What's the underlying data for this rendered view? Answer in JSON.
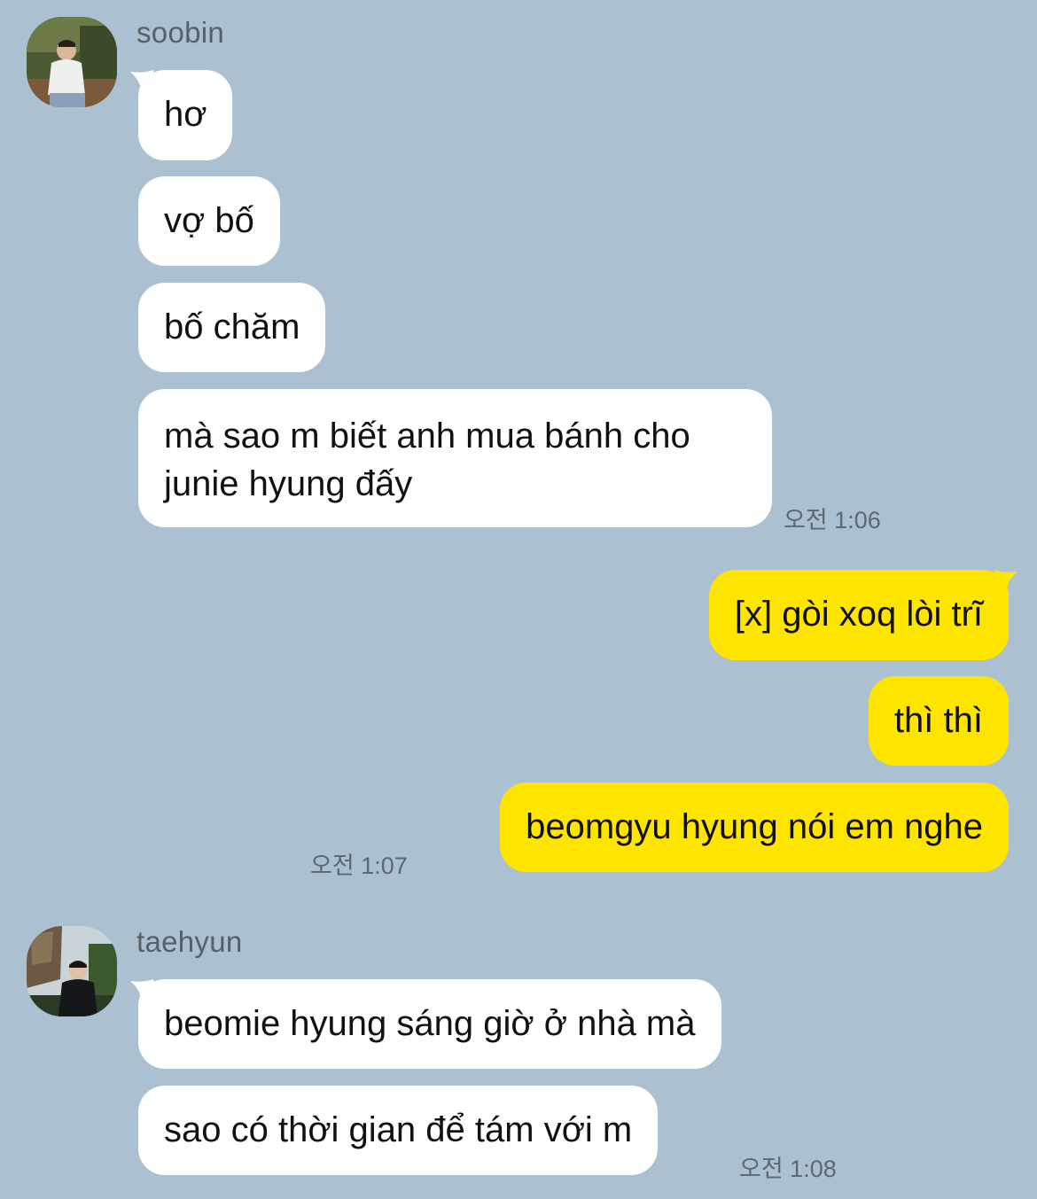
{
  "conversation": {
    "groups": [
      {
        "sender": "soobin",
        "avatar": "soobin-avatar",
        "messages": [
          "hơ",
          "vợ bố",
          "bố chăm",
          "mà sao m biết anh mua bánh cho junie hyung đấy"
        ],
        "timestamp": "오전 1:06"
      },
      {
        "sender": "me",
        "messages": [
          "[x] gòi xoq lòi trĩ",
          "thì thì",
          "beomgyu hyung nói em nghe"
        ],
        "timestamp": "오전 1:07"
      },
      {
        "sender": "taehyun",
        "avatar": "taehyun-avatar",
        "messages": [
          "beomie hyung sáng giờ ở nhà mà",
          "sao có thời gian để tám với m"
        ],
        "timestamp": "오전 1:08"
      }
    ]
  },
  "colors": {
    "background": "#abc1d1",
    "incoming_bubble": "#ffffff",
    "outgoing_bubble": "#fee500"
  }
}
